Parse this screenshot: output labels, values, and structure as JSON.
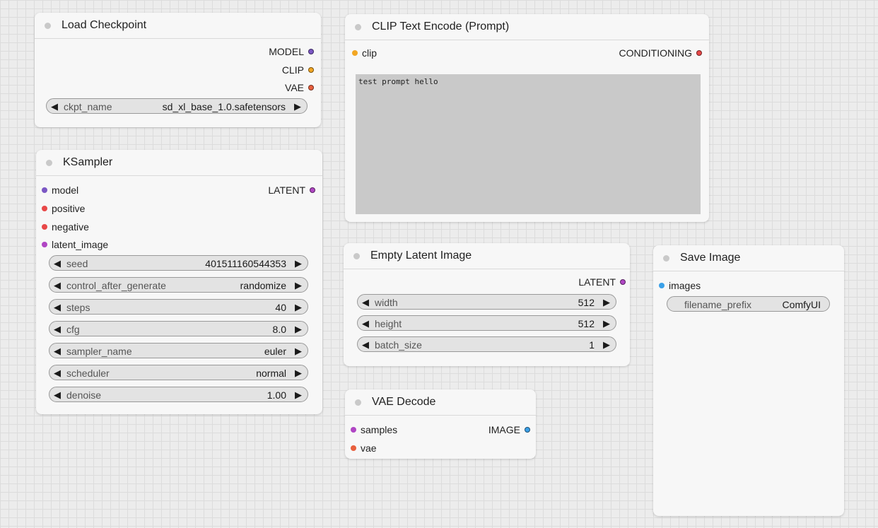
{
  "colors": {
    "model": "#7b57c4",
    "clip": "#f2a623",
    "vae": "#e85f3d",
    "conditioning": "#e84848",
    "latent": "#b046c4",
    "image": "#3aa0e8"
  },
  "load_checkpoint": {
    "title": "Load Checkpoint",
    "outputs": [
      "MODEL",
      "CLIP",
      "VAE"
    ],
    "ckpt_label": "ckpt_name",
    "ckpt_value": "sd_xl_base_1.0.safetensors"
  },
  "clip_encode": {
    "title": "CLIP Text Encode (Prompt)",
    "input": "clip",
    "output": "CONDITIONING",
    "text": "test prompt hello"
  },
  "ksampler": {
    "title": "KSampler",
    "inputs": [
      "model",
      "positive",
      "negative",
      "latent_image"
    ],
    "output": "LATENT",
    "widgets": [
      {
        "label": "seed",
        "value": "401511160544353"
      },
      {
        "label": "control_after_generate",
        "value": "randomize"
      },
      {
        "label": "steps",
        "value": "40"
      },
      {
        "label": "cfg",
        "value": "8.0"
      },
      {
        "label": "sampler_name",
        "value": "euler"
      },
      {
        "label": "scheduler",
        "value": "normal"
      },
      {
        "label": "denoise",
        "value": "1.00"
      }
    ]
  },
  "empty_latent": {
    "title": "Empty Latent Image",
    "output": "LATENT",
    "widgets": [
      {
        "label": "width",
        "value": "512"
      },
      {
        "label": "height",
        "value": "512"
      },
      {
        "label": "batch_size",
        "value": "1"
      }
    ]
  },
  "vae_decode": {
    "title": "VAE Decode",
    "inputs": [
      "samples",
      "vae"
    ],
    "output": "IMAGE"
  },
  "save_image": {
    "title": "Save Image",
    "input": "images",
    "widget_label": "filename_prefix",
    "widget_value": "ComfyUI"
  },
  "icons": {
    "left_arrow": "◀",
    "right_arrow": "▶"
  }
}
